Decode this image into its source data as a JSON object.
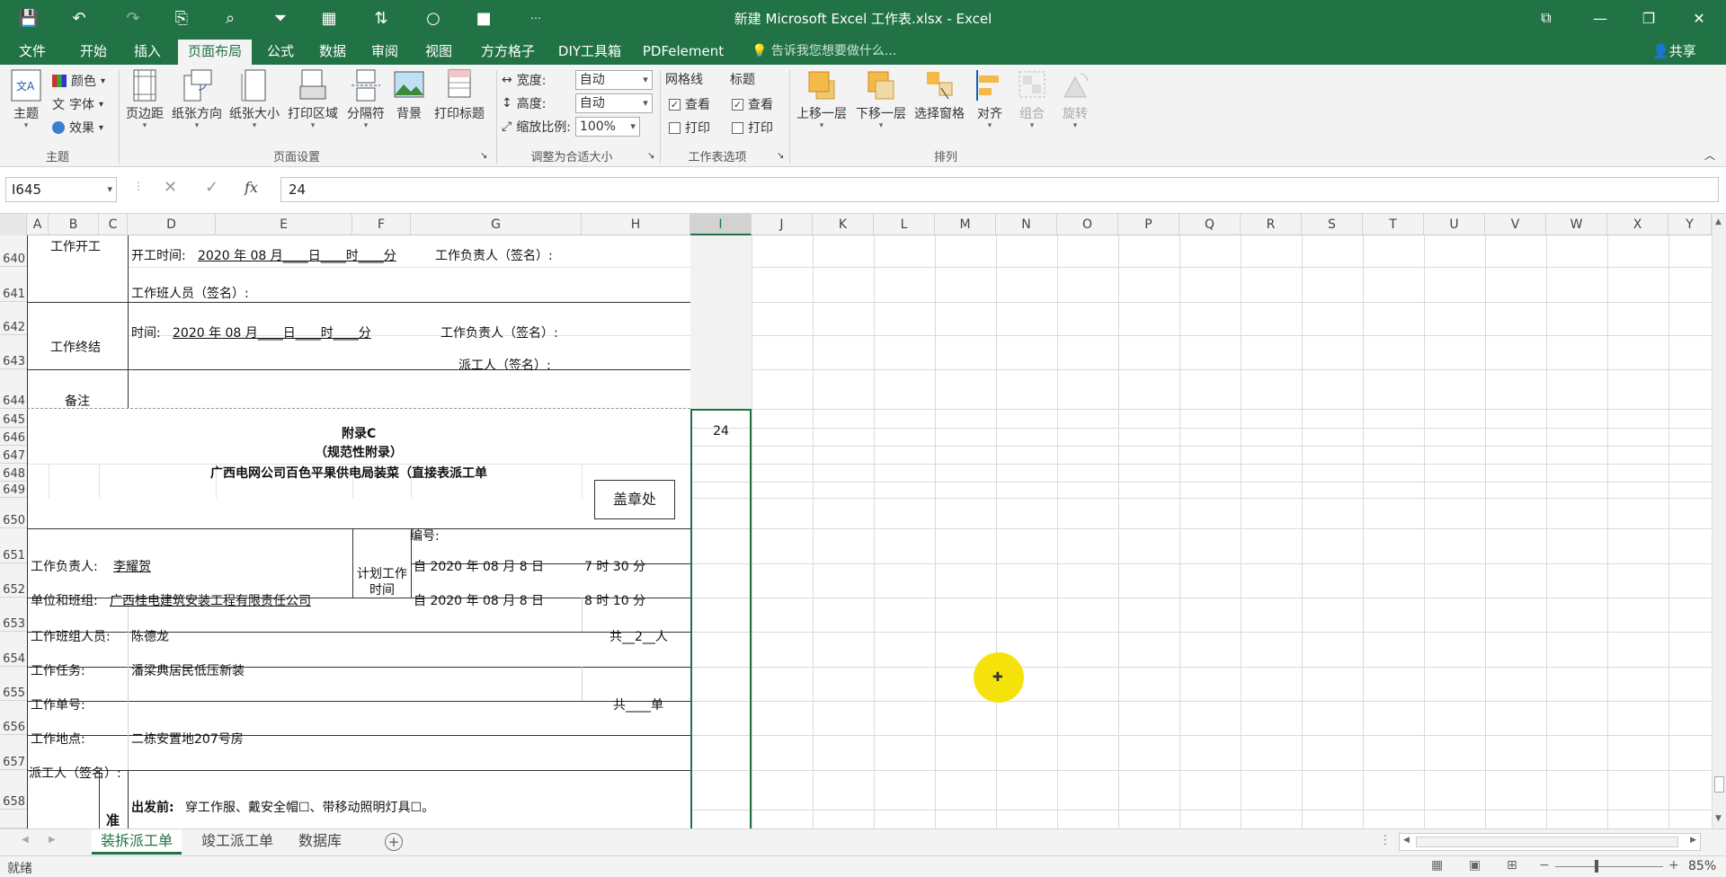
{
  "window": {
    "title": "新建 Microsoft Excel 工作表.xlsx - Excel"
  },
  "tabs": [
    "文件",
    "开始",
    "插入",
    "页面布局",
    "公式",
    "数据",
    "审阅",
    "视图",
    "方方格子",
    "DIY工具箱",
    "PDFelement"
  ],
  "active_tab": "页面布局",
  "tell_me": "告诉我您想要做什么...",
  "share": "共享",
  "ribbon": {
    "theme_group": {
      "label": "主题",
      "btn_theme": "主题",
      "colors": "颜色",
      "fonts": "字体",
      "effects": "效果"
    },
    "page_setup": {
      "label": "页面设置",
      "margins": "页边距",
      "orientation": "纸张方向",
      "size": "纸张大小",
      "print_area": "打印区域",
      "breaks": "分隔符",
      "background": "背景",
      "print_titles": "打印标题"
    },
    "scale_fit": {
      "label": "调整为合适大小",
      "width_label": "宽度:",
      "width_value": "自动",
      "height_label": "高度:",
      "height_value": "自动",
      "scale_label": "缩放比例:",
      "scale_value": "100%"
    },
    "sheet_options": {
      "label": "工作表选项",
      "gridlines": "网格线",
      "headings": "标题",
      "view": "查看",
      "print": "打印"
    },
    "arrange": {
      "label": "排列",
      "bring_forward": "上移一层",
      "send_backward": "下移一层",
      "selection_pane": "选择窗格",
      "align": "对齐",
      "group": "组合",
      "rotate": "旋转"
    }
  },
  "formula_bar": {
    "name_box": "I645",
    "fx": "fx",
    "formula": "24"
  },
  "columns": [
    "A",
    "B",
    "C",
    "D",
    "E",
    "F",
    "G",
    "H",
    "I",
    "J",
    "K",
    "L",
    "M",
    "N",
    "O",
    "P",
    "Q",
    "R",
    "S",
    "T",
    "U",
    "V",
    "W",
    "X",
    "Y"
  ],
  "rows": [
    "640",
    "641",
    "642",
    "643",
    "644",
    "645",
    "646",
    "647",
    "648",
    "649",
    "650",
    "651",
    "652",
    "653",
    "654",
    "655",
    "656",
    "657",
    "658"
  ],
  "cells": {
    "r640_a": "工作开工",
    "r640_d": "开工时间:",
    "r640_date": "2020 年  08  月____日____时____分",
    "r640_g": "工作负责人（签名）:",
    "r641_d": "工作班人员（签名）:",
    "r642_a": "工作终结",
    "r642_d": "时间:",
    "r642_date": "2020 年  08  月____日____时____分",
    "r642_g": "工作负责人（签名）:",
    "r643_g": "派工人（签名）:",
    "r644_a": "备注",
    "r645": "附录C",
    "r645_i": "24",
    "r646": "（规范性附录）",
    "r647": "广西电网公司百色平果供电局装菜（直接表派工单",
    "stamp": "盖章处",
    "r650_g": "编号:",
    "r651_a": "工作负责人:",
    "r651_name": "李耀贺",
    "plan_time": "计划工作时间",
    "r651_date": "自  2020   年  08   月 8  日",
    "r651_time": "7   时  30   分",
    "r652_a": "单位和班组:",
    "r652_unit": "广西桂电建筑安装工程有限责任公司",
    "r652_date": "自  2020   年  08   月 8  日",
    "r652_time": "8   时  10   分",
    "r653_a": "工作班组人员:",
    "r653_d": "陈德龙",
    "r653_h": "共__2__人",
    "r654_a": "工作任务:",
    "r654_d": "潘梁典居民低压新装",
    "r655_a": "工作单号:",
    "r655_h": "共____单",
    "r656_a": "工作地点:",
    "r656_d": "二栋安置地207号房",
    "r657_a": "派工人（签名）:",
    "r658_c": "准",
    "r658_bold": "出发前:",
    "r658_d": "穿工作服、戴安全帽☐、带移动照明灯具☐。"
  },
  "sheets": [
    "装拆派工单",
    "竣工派工单",
    "数据库"
  ],
  "active_sheet": "装拆派工单",
  "status": {
    "ready": "就绪",
    "zoom": "85%"
  }
}
